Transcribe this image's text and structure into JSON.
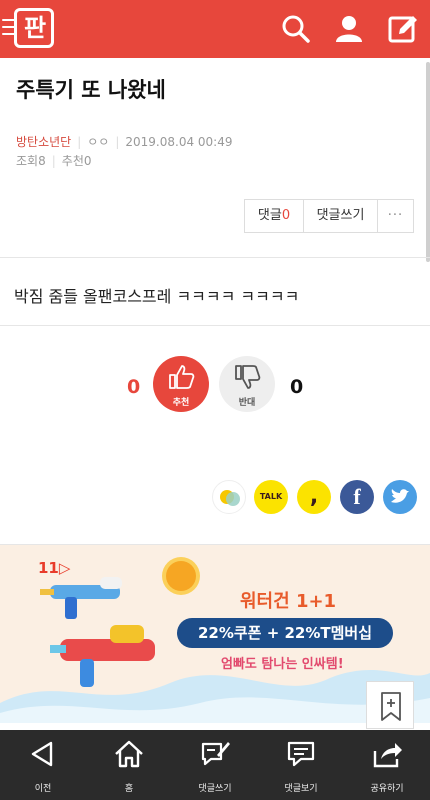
{
  "header": {
    "logo_text": "판",
    "icons": [
      "menu-icon",
      "search-icon",
      "user-icon",
      "write-icon"
    ],
    "accent_color": "#e7473c"
  },
  "article": {
    "title": "주특기 또 나왔네",
    "author": "방탄소년단",
    "emoji": "ㅇㅇ",
    "date": "2019.08.04 00:49",
    "views_label": "조회",
    "views": "8",
    "recommends_label": "추천",
    "recommends": "0",
    "comment_label": "댓글",
    "comment_count": "0",
    "write_comment_label": "댓글쓰기",
    "more_label": "···",
    "body": "박짐 줌들 올팬코스프레 ㅋㅋㅋㅋ ㅋㅋㅋㅋ"
  },
  "vote": {
    "up_count": "0",
    "up_label": "추천",
    "down_count": "0",
    "down_label": "반대"
  },
  "share": {
    "icons": [
      "kakaostory-icon",
      "kakaotalk-icon",
      "kakao-icon",
      "facebook-icon",
      "twitter-icon"
    ],
    "talk_text": "TALK",
    "kakao_text": ",",
    "facebook_text": "f",
    "twitter_text": "🐦"
  },
  "ad": {
    "brand": "11▷",
    "title": "워터건 1+1",
    "pill": "22%쿠폰 + 22%T멤버십",
    "subtitle": "엄빠도 탐나는 인싸템!"
  },
  "bottom_nav": {
    "items": [
      {
        "label": "이전",
        "icon": "back-icon"
      },
      {
        "label": "홈",
        "icon": "home-icon"
      },
      {
        "label": "댓글쓰기",
        "icon": "write-comment-icon"
      },
      {
        "label": "댓글보기",
        "icon": "view-comment-icon"
      },
      {
        "label": "공유하기",
        "icon": "share-icon"
      }
    ]
  }
}
